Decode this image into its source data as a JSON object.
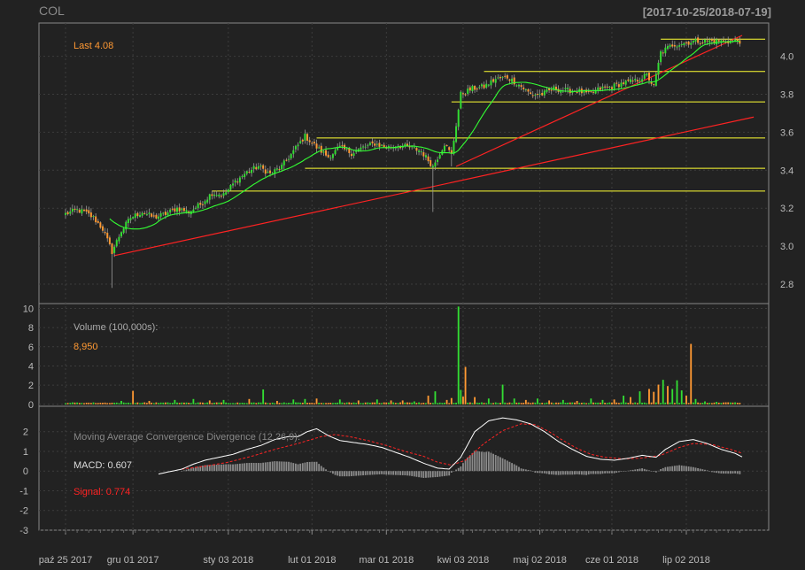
{
  "header": {
    "ticker": "COL",
    "range": "[2017-10-25/2018-07-19]"
  },
  "colors": {
    "background": "#222222",
    "frame": "#888888",
    "grid": "#3c3c3c",
    "axis_text": "#bbbbbb",
    "up": "#33dd33",
    "down": "#ff9933",
    "support": "#ffff33",
    "trend": "#ff2222",
    "sma": "#33ff33",
    "macd_line": "#ffffff",
    "signal_line": "#ff2222",
    "histogram": "#8a8a8a"
  },
  "chart_data": [
    {
      "panel": "price",
      "type": "candlestick",
      "last_label": "Last 4.08",
      "y_range": [
        2.73,
        4.11
      ],
      "y_ticks": [
        {
          "value": 2.8,
          "label": "2.8"
        },
        {
          "value": 3.0,
          "label": "3.0"
        },
        {
          "value": 3.2,
          "label": "3.2"
        },
        {
          "value": 3.4,
          "label": "3.4"
        },
        {
          "value": 3.6,
          "label": "3.6"
        },
        {
          "value": 3.8,
          "label": "3.8"
        },
        {
          "value": 4.0,
          "label": "4.0"
        }
      ],
      "anchors": [
        [
          0,
          3.17
        ],
        [
          5,
          3.19
        ],
        [
          8,
          3.18
        ],
        [
          12,
          3.15
        ],
        [
          16,
          3.09
        ],
        [
          20,
          2.97
        ],
        [
          24,
          3.08
        ],
        [
          28,
          3.15
        ],
        [
          33,
          3.18
        ],
        [
          38,
          3.15
        ],
        [
          43,
          3.17
        ],
        [
          48,
          3.2
        ],
        [
          53,
          3.18
        ],
        [
          58,
          3.22
        ],
        [
          63,
          3.28
        ],
        [
          68,
          3.27
        ],
        [
          73,
          3.34
        ],
        [
          78,
          3.39
        ],
        [
          83,
          3.42
        ],
        [
          88,
          3.38
        ],
        [
          93,
          3.42
        ],
        [
          98,
          3.5
        ],
        [
          103,
          3.58
        ],
        [
          108,
          3.52
        ],
        [
          113,
          3.47
        ],
        [
          118,
          3.52
        ],
        [
          123,
          3.49
        ],
        [
          128,
          3.52
        ],
        [
          133,
          3.54
        ],
        [
          138,
          3.52
        ],
        [
          143,
          3.53
        ],
        [
          148,
          3.52
        ],
        [
          153,
          3.5
        ],
        [
          158,
          3.42
        ],
        [
          163,
          3.54
        ],
        [
          166,
          3.48
        ],
        [
          170,
          3.8
        ],
        [
          175,
          3.83
        ],
        [
          180,
          3.84
        ],
        [
          185,
          3.88
        ],
        [
          190,
          3.89
        ],
        [
          195,
          3.85
        ],
        [
          200,
          3.8
        ],
        [
          205,
          3.8
        ],
        [
          210,
          3.83
        ],
        [
          215,
          3.82
        ],
        [
          220,
          3.82
        ],
        [
          225,
          3.8
        ],
        [
          230,
          3.83
        ],
        [
          235,
          3.84
        ],
        [
          240,
          3.86
        ],
        [
          245,
          3.87
        ],
        [
          250,
          3.9
        ],
        [
          253,
          3.84
        ],
        [
          256,
          4.02
        ],
        [
          261,
          4.06
        ],
        [
          266,
          4.07
        ],
        [
          271,
          4.08
        ],
        [
          276,
          4.08
        ],
        [
          281,
          4.08
        ],
        [
          286,
          4.08
        ],
        [
          290,
          4.08
        ]
      ],
      "spikes": [
        {
          "index": 20,
          "low": 2.78
        },
        {
          "index": 158,
          "low": 3.18
        },
        {
          "index": 166,
          "low": 3.42
        }
      ],
      "support_levels": [
        {
          "value": 3.29,
          "from": 63
        },
        {
          "value": 3.41,
          "from": 103
        },
        {
          "value": 3.57,
          "from": 108
        },
        {
          "value": 3.76,
          "from": 166
        },
        {
          "value": 3.92,
          "from": 180
        },
        {
          "value": 4.09,
          "from": 256
        }
      ],
      "trend_lines": [
        {
          "from": [
            21,
            2.95
          ],
          "to": [
            296,
            3.68
          ]
        },
        {
          "from": [
            168,
            3.42
          ],
          "to": [
            291,
            4.11
          ]
        }
      ],
      "sma_period": 20
    },
    {
      "panel": "volume",
      "type": "bar",
      "label": "Volume (100,000s):",
      "last_value_label": "8,950",
      "y_range": [
        -0.3,
        10.6
      ],
      "y_ticks": [
        {
          "value": 0,
          "label": "0"
        },
        {
          "value": 2,
          "label": "2"
        },
        {
          "value": 4,
          "label": "4"
        },
        {
          "value": 6,
          "label": "6"
        },
        {
          "value": 8,
          "label": "8"
        },
        {
          "value": 10,
          "label": "10"
        }
      ],
      "base": 0.12,
      "spikes": [
        [
          24,
          0.35,
          1
        ],
        [
          29,
          1.4,
          0
        ],
        [
          36,
          0.35,
          0
        ],
        [
          47,
          0.45,
          1
        ],
        [
          55,
          0.55,
          1
        ],
        [
          62,
          0.4,
          0
        ],
        [
          68,
          0.45,
          1
        ],
        [
          79,
          0.55,
          0
        ],
        [
          85,
          1.55,
          1
        ],
        [
          91,
          0.35,
          0
        ],
        [
          98,
          0.5,
          1
        ],
        [
          103,
          0.55,
          1
        ],
        [
          108,
          0.6,
          0
        ],
        [
          118,
          0.5,
          1
        ],
        [
          126,
          0.4,
          0
        ],
        [
          134,
          0.5,
          1
        ],
        [
          140,
          0.4,
          0
        ],
        [
          145,
          0.4,
          0
        ],
        [
          150,
          0.3,
          1
        ],
        [
          156,
          0.9,
          0
        ],
        [
          159,
          1.35,
          1
        ],
        [
          164,
          0.45,
          0
        ],
        [
          166,
          0.65,
          0
        ],
        [
          169,
          10.2,
          1
        ],
        [
          170,
          1.5,
          1
        ],
        [
          171,
          0.8,
          0
        ],
        [
          172,
          3.9,
          0
        ],
        [
          176,
          0.75,
          0
        ],
        [
          182,
          0.6,
          1
        ],
        [
          188,
          2.05,
          1
        ],
        [
          193,
          0.6,
          1
        ],
        [
          198,
          0.45,
          0
        ],
        [
          203,
          0.6,
          1
        ],
        [
          208,
          0.4,
          0
        ],
        [
          214,
          0.45,
          1
        ],
        [
          220,
          0.35,
          0
        ],
        [
          226,
          0.6,
          1
        ],
        [
          231,
          0.45,
          1
        ],
        [
          236,
          0.5,
          0
        ],
        [
          240,
          0.9,
          1
        ],
        [
          243,
          0.75,
          0
        ],
        [
          247,
          1.35,
          1
        ],
        [
          251,
          1.6,
          0
        ],
        [
          253,
          1.3,
          0
        ],
        [
          255,
          2.05,
          0
        ],
        [
          257,
          2.55,
          1
        ],
        [
          259,
          1.9,
          0
        ],
        [
          261,
          1.6,
          1
        ],
        [
          263,
          2.5,
          1
        ],
        [
          265,
          1.45,
          1
        ],
        [
          267,
          0.9,
          0
        ],
        [
          269,
          6.3,
          0
        ],
        [
          271,
          0.55,
          1
        ],
        [
          275,
          0.3,
          1
        ],
        [
          280,
          0.25,
          1
        ],
        [
          284,
          0.2,
          0
        ],
        [
          288,
          0.2,
          1
        ]
      ]
    },
    {
      "panel": "macd",
      "type": "line+bar",
      "title": "Moving Average Convergence Divergence (12,26,9):",
      "macd_label": "MACD: 0.607",
      "signal_label": "Signal: 0.774",
      "y_range": [
        -3,
        3.2
      ],
      "y_ticks": [
        {
          "value": -3,
          "label": "-3"
        },
        {
          "value": -2,
          "label": "-2"
        },
        {
          "value": -1,
          "label": "-1"
        },
        {
          "value": 0,
          "label": "0"
        },
        {
          "value": 1,
          "label": "1"
        },
        {
          "value": 2,
          "label": "2"
        }
      ],
      "macd": [
        [
          40,
          -0.15
        ],
        [
          50,
          0.1
        ],
        [
          55,
          0.35
        ],
        [
          60,
          0.55
        ],
        [
          66,
          0.7
        ],
        [
          72,
          0.85
        ],
        [
          78,
          1.1
        ],
        [
          84,
          1.3
        ],
        [
          90,
          1.6
        ],
        [
          96,
          1.75
        ],
        [
          100,
          1.75
        ],
        [
          104,
          2.0
        ],
        [
          108,
          2.15
        ],
        [
          113,
          1.8
        ],
        [
          118,
          1.55
        ],
        [
          124,
          1.45
        ],
        [
          130,
          1.35
        ],
        [
          136,
          1.2
        ],
        [
          142,
          0.95
        ],
        [
          148,
          0.7
        ],
        [
          154,
          0.4
        ],
        [
          160,
          0.15
        ],
        [
          165,
          0.1
        ],
        [
          170,
          0.7
        ],
        [
          176,
          2.0
        ],
        [
          182,
          2.55
        ],
        [
          188,
          2.7
        ],
        [
          194,
          2.6
        ],
        [
          200,
          2.4
        ],
        [
          206,
          2.0
        ],
        [
          212,
          1.5
        ],
        [
          218,
          1.1
        ],
        [
          224,
          0.75
        ],
        [
          230,
          0.6
        ],
        [
          236,
          0.55
        ],
        [
          242,
          0.65
        ],
        [
          248,
          0.8
        ],
        [
          254,
          0.7
        ],
        [
          258,
          1.1
        ],
        [
          264,
          1.5
        ],
        [
          270,
          1.6
        ],
        [
          276,
          1.4
        ],
        [
          282,
          1.1
        ],
        [
          288,
          0.9
        ],
        [
          291,
          0.72
        ]
      ],
      "signal": [
        [
          50,
          0.1
        ],
        [
          60,
          0.25
        ],
        [
          70,
          0.45
        ],
        [
          80,
          0.75
        ],
        [
          90,
          1.1
        ],
        [
          100,
          1.4
        ],
        [
          110,
          1.75
        ],
        [
          116,
          1.85
        ],
        [
          122,
          1.75
        ],
        [
          130,
          1.55
        ],
        [
          138,
          1.3
        ],
        [
          146,
          1.0
        ],
        [
          154,
          0.75
        ],
        [
          160,
          0.45
        ],
        [
          166,
          0.3
        ],
        [
          172,
          0.55
        ],
        [
          180,
          1.4
        ],
        [
          188,
          2.05
        ],
        [
          196,
          2.4
        ],
        [
          202,
          2.35
        ],
        [
          208,
          2.0
        ],
        [
          214,
          1.55
        ],
        [
          220,
          1.15
        ],
        [
          226,
          0.85
        ],
        [
          232,
          0.7
        ],
        [
          240,
          0.62
        ],
        [
          248,
          0.66
        ],
        [
          256,
          0.8
        ],
        [
          264,
          1.2
        ],
        [
          270,
          1.4
        ],
        [
          278,
          1.35
        ],
        [
          286,
          1.1
        ],
        [
          291,
          0.9
        ]
      ]
    }
  ],
  "x_axis": {
    "n_bars": 291,
    "ticks": [
      {
        "index": 0,
        "label": "paź 25 2017"
      },
      {
        "index": 29,
        "label": "gru 01 2017"
      },
      {
        "index": 70,
        "label": "sty 03 2018"
      },
      {
        "index": 106,
        "label": "lut 01 2018"
      },
      {
        "index": 138,
        "label": "mar 01 2018"
      },
      {
        "index": 171,
        "label": "kwi 03 2018"
      },
      {
        "index": 204,
        "label": "maj 02 2018"
      },
      {
        "index": 235,
        "label": "cze 01 2018"
      },
      {
        "index": 267,
        "label": "lip 02 2018"
      }
    ]
  }
}
